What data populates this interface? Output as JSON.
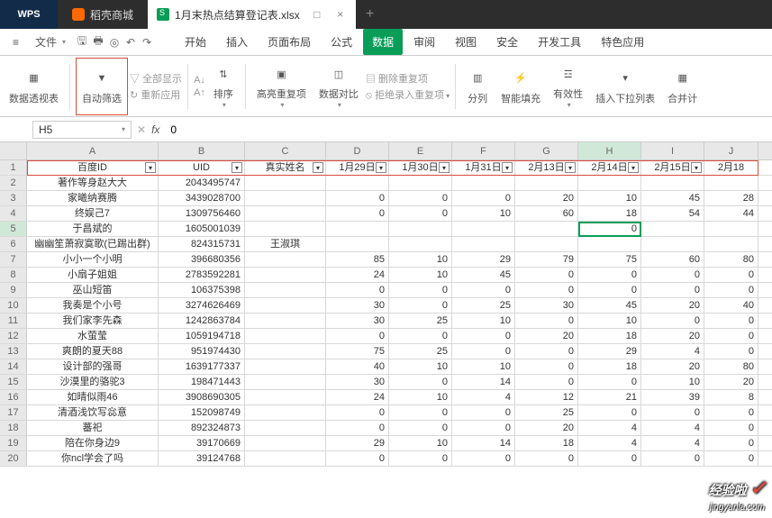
{
  "titlebar": {
    "wps_label": "WPS",
    "app_tab": "稻壳商城",
    "doc_tab": "1月末热点结算登记表.xlsx",
    "close": "×",
    "restore": "□",
    "plus": "+"
  },
  "menubar": {
    "file": "文件",
    "tabs": [
      "开始",
      "插入",
      "页面布局",
      "公式",
      "数据",
      "审阅",
      "视图",
      "安全",
      "开发工具",
      "特色应用"
    ],
    "active_index": 4
  },
  "ribbon": {
    "pivot": "数据透视表",
    "autofilter": "自动筛选",
    "showall": "全部显示",
    "reapply": "重新应用",
    "sort": "排序",
    "highlight_dup": "高亮重复项",
    "data_compare": "数据对比",
    "delete_dup": "删除重复项",
    "reject_dup": "拒绝录入重复项",
    "split": "分列",
    "smartfill": "智能填充",
    "validation": "有效性",
    "dropdown_list": "插入下拉列表",
    "consolidate": "合并计"
  },
  "formulabar": {
    "namebox": "H5",
    "fx": "fx",
    "value": "0"
  },
  "columns": [
    "A",
    "B",
    "C",
    "D",
    "E",
    "F",
    "G",
    "H",
    "I",
    "J"
  ],
  "headers": {
    "A": "百度ID",
    "B": "UID",
    "C": "真实姓名",
    "D": "1月29日",
    "E": "1月30日",
    "F": "1月31日",
    "G": "2月13日",
    "H": "2月14日",
    "I": "2月15日",
    "J": "2月18"
  },
  "rows": [
    {
      "n": 2,
      "A": "著作等身赵大大",
      "B": "2043495747",
      "C": "",
      "D": "",
      "E": "",
      "F": "",
      "G": "",
      "H": "",
      "I": "",
      "J": ""
    },
    {
      "n": 3,
      "A": "家曦纳赛腾",
      "B": "3439028700",
      "C": "",
      "D": "0",
      "E": "0",
      "F": "0",
      "G": "20",
      "H": "10",
      "I": "45",
      "J": "28"
    },
    {
      "n": 4,
      "A": "终娱己7",
      "B": "1309756460",
      "C": "",
      "D": "0",
      "E": "0",
      "F": "10",
      "G": "60",
      "H": "18",
      "I": "54",
      "J": "44"
    },
    {
      "n": 5,
      "A": "于昌斌的",
      "B": "1605001039",
      "C": "",
      "D": "",
      "E": "",
      "F": "",
      "G": "",
      "H": "0",
      "I": "",
      "J": ""
    },
    {
      "n": 6,
      "A": "幽幽笙萧寂寞歌(已踢出群)",
      "B": "824315731",
      "C": "王淑琪",
      "D": "",
      "E": "",
      "F": "",
      "G": "",
      "H": "",
      "I": "",
      "J": ""
    },
    {
      "n": 7,
      "A": "小小一个小明",
      "B": "396680356",
      "C": "",
      "D": "85",
      "E": "10",
      "F": "29",
      "G": "79",
      "H": "75",
      "I": "60",
      "J": "80"
    },
    {
      "n": 8,
      "A": "小扇子姐姐",
      "B": "2783592281",
      "C": "",
      "D": "24",
      "E": "10",
      "F": "45",
      "G": "0",
      "H": "0",
      "I": "0",
      "J": "0"
    },
    {
      "n": 9,
      "A": "巫山短笛",
      "B": "106375398",
      "C": "",
      "D": "0",
      "E": "0",
      "F": "0",
      "G": "0",
      "H": "0",
      "I": "0",
      "J": "0"
    },
    {
      "n": 10,
      "A": "我奏是个小号",
      "B": "3274626469",
      "C": "",
      "D": "30",
      "E": "0",
      "F": "25",
      "G": "30",
      "H": "45",
      "I": "20",
      "J": "40"
    },
    {
      "n": 11,
      "A": "我们家李先森",
      "B": "1242863784",
      "C": "",
      "D": "30",
      "E": "25",
      "F": "10",
      "G": "0",
      "H": "10",
      "I": "0",
      "J": "0"
    },
    {
      "n": 12,
      "A": "水萤莹",
      "B": "1059194718",
      "C": "",
      "D": "0",
      "E": "0",
      "F": "0",
      "G": "20",
      "H": "18",
      "I": "20",
      "J": "0"
    },
    {
      "n": 13,
      "A": "爽朗的夏天88",
      "B": "951974430",
      "C": "",
      "D": "75",
      "E": "25",
      "F": "0",
      "G": "0",
      "H": "29",
      "I": "4",
      "J": "0"
    },
    {
      "n": 14,
      "A": "设计部的强哥",
      "B": "1639177337",
      "C": "",
      "D": "40",
      "E": "10",
      "F": "10",
      "G": "0",
      "H": "18",
      "I": "20",
      "J": "80"
    },
    {
      "n": 15,
      "A": "沙漠里的骆驼3",
      "B": "198471443",
      "C": "",
      "D": "30",
      "E": "0",
      "F": "14",
      "G": "0",
      "H": "0",
      "I": "10",
      "J": "20"
    },
    {
      "n": 16,
      "A": "如晴似雨46",
      "B": "3908690305",
      "C": "",
      "D": "24",
      "E": "10",
      "F": "4",
      "G": "12",
      "H": "21",
      "I": "39",
      "J": "8"
    },
    {
      "n": 17,
      "A": "清酒浅饮写惢意",
      "B": "152098749",
      "C": "",
      "D": "0",
      "E": "0",
      "F": "0",
      "G": "25",
      "H": "0",
      "I": "0",
      "J": "0"
    },
    {
      "n": 18,
      "A": "蕃祀",
      "B": "892324873",
      "C": "",
      "D": "0",
      "E": "0",
      "F": "0",
      "G": "20",
      "H": "4",
      "I": "4",
      "J": "0"
    },
    {
      "n": 19,
      "A": "陪在你身边9",
      "B": "39170669",
      "C": "",
      "D": "29",
      "E": "10",
      "F": "14",
      "G": "18",
      "H": "4",
      "I": "4",
      "J": "0"
    },
    {
      "n": 20,
      "A": "你ncl学会了吗",
      "B": "39124768",
      "C": "",
      "D": "0",
      "E": "0",
      "F": "0",
      "G": "0",
      "H": "0",
      "I": "0",
      "J": "0"
    }
  ],
  "watermark": {
    "text": "经验啦",
    "sub": "jingyanla.com"
  }
}
